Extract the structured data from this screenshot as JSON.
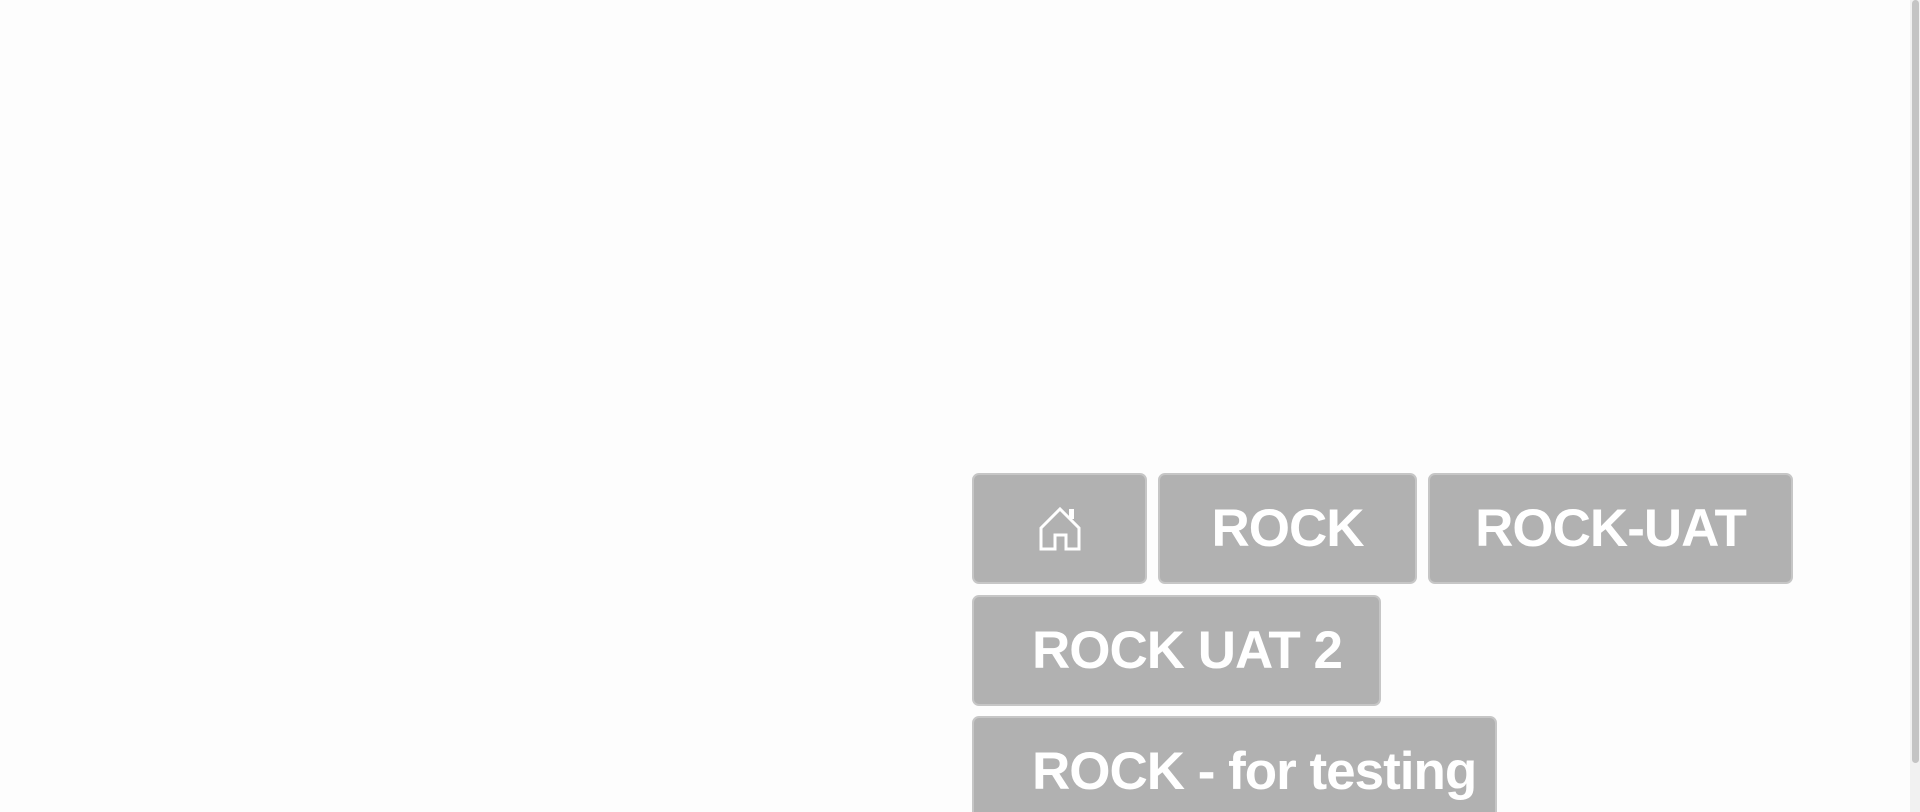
{
  "tiles": {
    "home": {
      "icon": "home-icon"
    },
    "rock": {
      "label": "ROCK"
    },
    "rock_uat": {
      "label": "ROCK-UAT"
    },
    "rock_uat_2": {
      "label": "ROCK UAT 2"
    },
    "rock_testing": {
      "label": "ROCK - for testing"
    }
  },
  "colors": {
    "tile_background": "#b1b1b1",
    "tile_border": "#c6c6c6",
    "tile_text": "#ffffff",
    "page_background": "#fdfdfd"
  }
}
